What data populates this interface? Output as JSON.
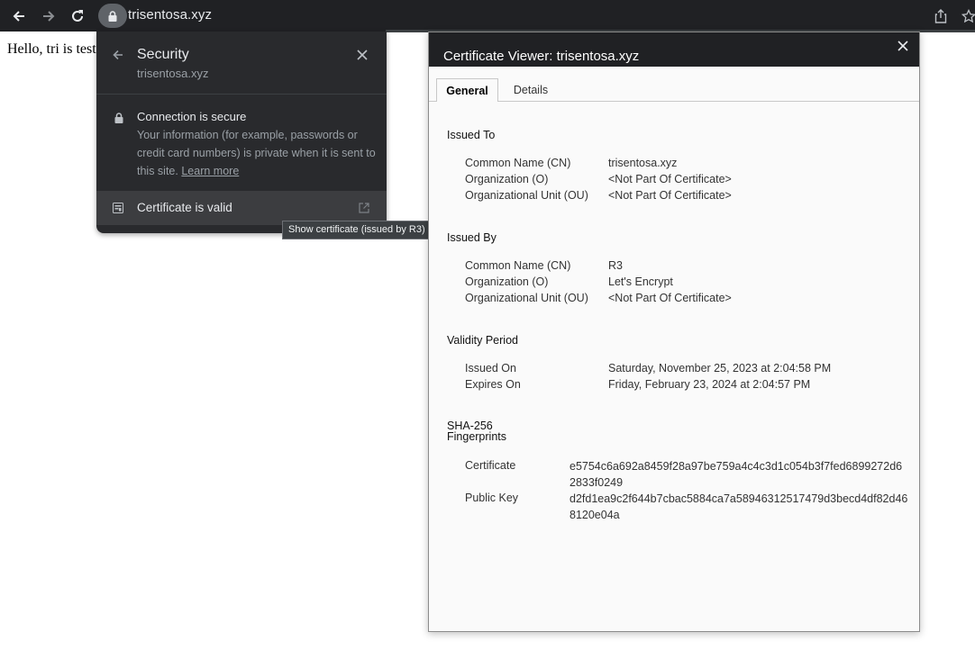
{
  "browser": {
    "url": "trisentosa.xyz",
    "colors": {
      "toolbar": "#202124",
      "popup": "#292a2d"
    }
  },
  "page": {
    "body_text": "Hello, tri is test"
  },
  "security_popup": {
    "title": "Security",
    "subtitle": "trisentosa.xyz",
    "connection_title": "Connection is secure",
    "connection_desc": "Your information (for example, passwords or credit card numbers) is private when it is sent to this site.",
    "learn_more": "Learn more",
    "certificate_label": "Certificate is valid"
  },
  "tooltip": {
    "text": "Show certificate (issued by R3)"
  },
  "cert_viewer": {
    "title": "Certificate Viewer: trisentosa.xyz",
    "tabs": [
      {
        "label": "General",
        "active": true
      },
      {
        "label": "Details",
        "active": false
      }
    ],
    "issued_to": {
      "heading": "Issued To",
      "rows": [
        {
          "label": "Common Name (CN)",
          "value": "trisentosa.xyz"
        },
        {
          "label": "Organization (O)",
          "value": "<Not Part Of Certificate>"
        },
        {
          "label": "Organizational Unit (OU)",
          "value": "<Not Part Of Certificate>"
        }
      ]
    },
    "issued_by": {
      "heading": "Issued By",
      "rows": [
        {
          "label": "Common Name (CN)",
          "value": "R3"
        },
        {
          "label": "Organization (O)",
          "value": "Let's Encrypt"
        },
        {
          "label": "Organizational Unit (OU)",
          "value": "<Not Part Of Certificate>"
        }
      ]
    },
    "validity": {
      "heading": "Validity Period",
      "rows": [
        {
          "label": "Issued On",
          "value": "Saturday, November 25, 2023 at 2:04:58 PM"
        },
        {
          "label": "Expires On",
          "value": "Friday, February 23, 2024 at 2:04:57 PM"
        }
      ]
    },
    "fingerprints": {
      "heading_line1": "SHA-256",
      "heading_line2": "Fingerprints",
      "rows": [
        {
          "label": "Certificate",
          "value": "e5754c6a692a8459f28a97be759a4c4c3d1c054b3f7fed6899272d62833f0249"
        },
        {
          "label": "Public Key",
          "value": "d2fd1ea9c2f644b7cbac5884ca7a58946312517479d3becd4df82d468120e04a"
        }
      ]
    }
  }
}
